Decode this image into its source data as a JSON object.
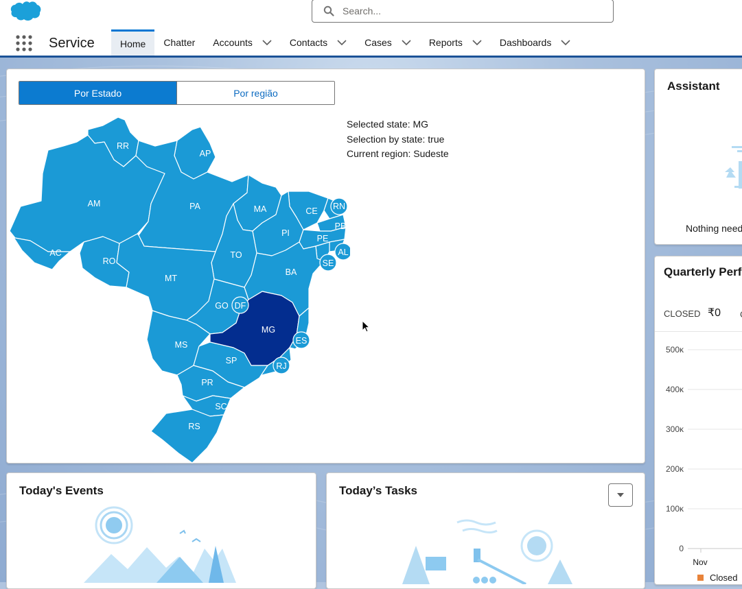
{
  "app": {
    "name": "Service"
  },
  "search": {
    "placeholder": "Search..."
  },
  "nav": {
    "items": [
      {
        "label": "Home",
        "active": true
      },
      {
        "label": "Chatter"
      },
      {
        "label": "Accounts",
        "has_menu": true
      },
      {
        "label": "Contacts",
        "has_menu": true
      },
      {
        "label": "Cases",
        "has_menu": true
      },
      {
        "label": "Reports",
        "has_menu": true
      },
      {
        "label": "Dashboards",
        "has_menu": true
      }
    ]
  },
  "map_card": {
    "tabs": [
      {
        "label": "Por Estado",
        "selected": true
      },
      {
        "label": "Por região",
        "selected": false
      }
    ],
    "info": {
      "selected_state": "Selected state: MG",
      "selection_by_state": "Selection by state: true",
      "current_region": "Current region: Sudeste"
    },
    "states": [
      "RR",
      "AP",
      "AM",
      "PA",
      "MA",
      "CE",
      "RN",
      "PB",
      "PE",
      "AL",
      "SE",
      "PI",
      "AC",
      "RO",
      "TO",
      "BA",
      "MT",
      "GO",
      "DF",
      "MG",
      "ES",
      "MS",
      "SP",
      "RJ",
      "PR",
      "SC",
      "RS"
    ],
    "selected": "MG",
    "colors": {
      "state": "#1b9ad6",
      "selected": "#032d8f"
    }
  },
  "assistant": {
    "title": "Assistant",
    "message": "Nothing need"
  },
  "quarterly": {
    "title": "Quarterly Perf",
    "closed_label": "CLOSED",
    "closed_value": "₹0",
    "extra_label": "C",
    "chart_data": {
      "type": "line",
      "y_ticks": [
        "500κ",
        "400κ",
        "300κ",
        "200κ",
        "100κ",
        "0"
      ],
      "x_ticks": [
        "Nov"
      ],
      "legend": [
        "Closed"
      ],
      "legend_colors": [
        "#e8833a"
      ]
    }
  },
  "events": {
    "title": "Today's Events"
  },
  "tasks": {
    "title": "Today’s Tasks"
  },
  "colors": {
    "brand": "#0176d3",
    "header_bar": "#1b5297"
  }
}
